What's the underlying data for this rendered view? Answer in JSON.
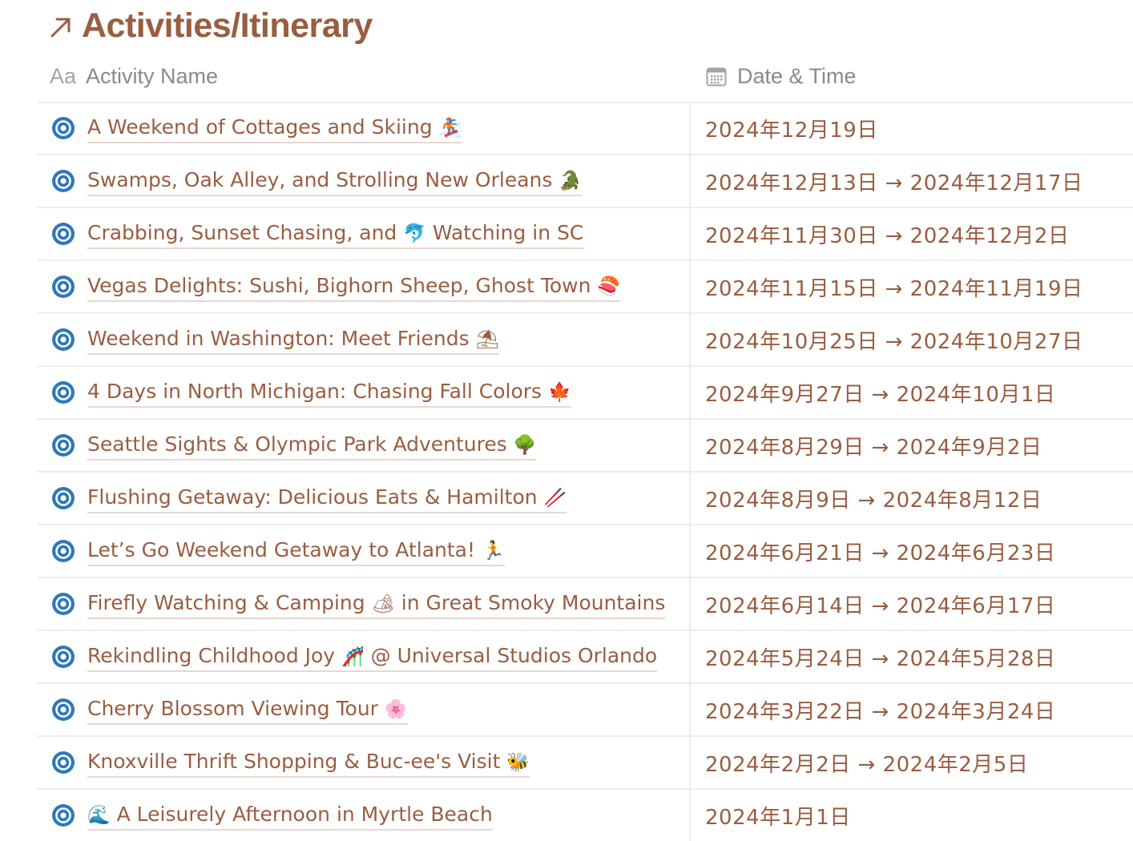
{
  "database": {
    "title": "Activities/Itinerary",
    "link_icon": "arrow-up-right-icon"
  },
  "columns": [
    {
      "icon": "text-type-icon",
      "icon_text": "Aa",
      "label": "Activity Name"
    },
    {
      "icon": "calendar-icon",
      "label": "Date & Time"
    }
  ],
  "colors": {
    "accent": "#9a5d40",
    "header_text": "#8b8a86",
    "page_icon": "#2f78b8",
    "divider": "#ededec"
  },
  "rows": [
    {
      "title": "A Weekend of Cottages and Skiing",
      "emoji": "🏂",
      "date": "2024年12月19日"
    },
    {
      "title": "Swamps, Oak Alley, and Strolling New Orleans",
      "emoji": "🐊",
      "date": "2024年12月13日 → 2024年12月17日"
    },
    {
      "title": "Crabbing, Sunset Chasing, and ",
      "emoji": "🐬",
      "title_suffix": " Watching in SC",
      "date": "2024年11月30日 → 2024年12月2日"
    },
    {
      "title": "Vegas Delights: Sushi, Bighorn Sheep, Ghost Town",
      "emoji": "🍣",
      "date": "2024年11月15日 → 2024年11月19日"
    },
    {
      "title": "Weekend in Washington: Meet Friends",
      "emoji": "⛱",
      "date": "2024年10月25日 → 2024年10月27日"
    },
    {
      "title": "4 Days in North Michigan: Chasing Fall Colors",
      "emoji": "🍁",
      "date": "2024年9月27日 → 2024年10月1日"
    },
    {
      "title": "Seattle Sights & Olympic Park Adventures",
      "emoji": "🌳",
      "date": "2024年8月29日 → 2024年9月2日"
    },
    {
      "title": "Flushing Getaway: Delicious Eats & Hamilton",
      "emoji": "🥢",
      "date": "2024年8月9日 → 2024年8月12日"
    },
    {
      "title": "Let’s Go Weekend Getaway to Atlanta!",
      "emoji": "🏃",
      "date": "2024年6月21日 → 2024年6月23日"
    },
    {
      "title": "Firefly Watching & Camping ",
      "emoji": "🏕",
      "title_suffix": " in Great Smoky Mountains",
      "date": "2024年6月14日 → 2024年6月17日"
    },
    {
      "title": "Rekindling Childhood Joy ",
      "emoji": "🎢",
      "title_suffix": " @ Universal Studios Orlando",
      "date": "2024年5月24日 → 2024年5月28日"
    },
    {
      "title": "Cherry Blossom Viewing Tour",
      "emoji": "🌸",
      "date": "2024年3月22日 → 2024年3月24日"
    },
    {
      "title": "Knoxville Thrift Shopping & Buc-ee's Visit",
      "emoji": "🐝",
      "date": "2024年2月2日 → 2024年2月5日"
    },
    {
      "emoji_prefix": "🌊",
      "title": " A Leisurely Afternoon in Myrtle Beach",
      "date": "2024年1月1日"
    }
  ]
}
